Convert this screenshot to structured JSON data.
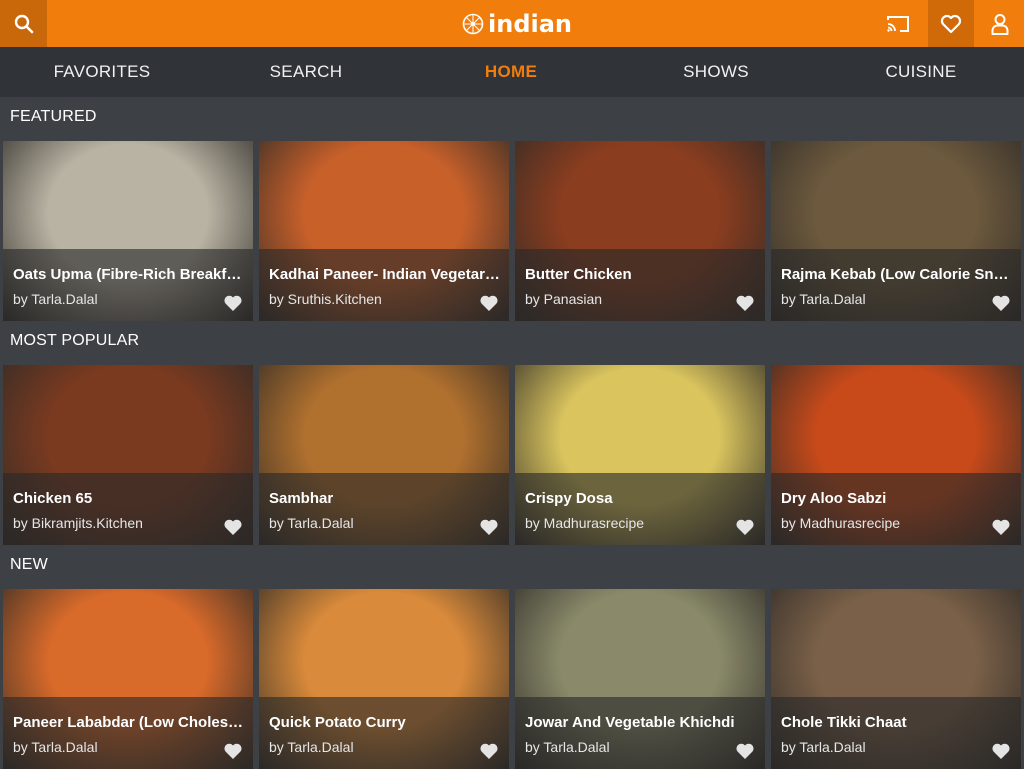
{
  "header": {
    "logo_text": "indian",
    "icons": [
      "search-icon",
      "cast-icon",
      "heart-icon",
      "user-icon"
    ],
    "accent_color": "#f07d0c"
  },
  "nav": {
    "tabs": [
      {
        "label": "FAVORITES",
        "active": false
      },
      {
        "label": "SEARCH",
        "active": false
      },
      {
        "label": "HOME",
        "active": true
      },
      {
        "label": "SHOWS",
        "active": false
      },
      {
        "label": "CUISINE",
        "active": false
      }
    ]
  },
  "sections": [
    {
      "title": "FEATURED",
      "cards": [
        {
          "title": "Oats Upma (Fibre-Rich Breakfast)",
          "author": "by Tarla.Dalal",
          "bg": "#b9b3a3"
        },
        {
          "title": "Kadhai Paneer- Indian Vegetarian",
          "author": "by Sruthis.Kitchen",
          "bg": "#c8602a"
        },
        {
          "title": "Butter Chicken",
          "author": "by Panasian",
          "bg": "#8a3d1f"
        },
        {
          "title": "Rajma Kebab (Low Calorie Snack)",
          "author": "by Tarla.Dalal",
          "bg": "#6d5a3e"
        }
      ]
    },
    {
      "title": "MOST POPULAR",
      "cards": [
        {
          "title": "Chicken 65",
          "author": "by Bikramjits.Kitchen",
          "bg": "#7a3a20"
        },
        {
          "title": "Sambhar",
          "author": "by Tarla.Dalal",
          "bg": "#b0702e"
        },
        {
          "title": "Crispy Dosa",
          "author": "by Madhurasrecipe",
          "bg": "#d9c45e"
        },
        {
          "title": "Dry Aloo Sabzi",
          "author": "by Madhurasrecipe",
          "bg": "#c84a1a"
        }
      ]
    },
    {
      "title": "NEW",
      "cards": [
        {
          "title": "Paneer Lababdar (Low Cholesterol)",
          "author": "by Tarla.Dalal",
          "bg": "#d86a2a"
        },
        {
          "title": "Quick Potato Curry",
          "author": "by Tarla.Dalal",
          "bg": "#d98a3a"
        },
        {
          "title": "Jowar And Vegetable Khichdi",
          "author": "by Tarla.Dalal",
          "bg": "#8a8a6a"
        },
        {
          "title": "Chole Tikki Chaat",
          "author": "by Tarla.Dalal",
          "bg": "#7a6048"
        }
      ]
    }
  ]
}
